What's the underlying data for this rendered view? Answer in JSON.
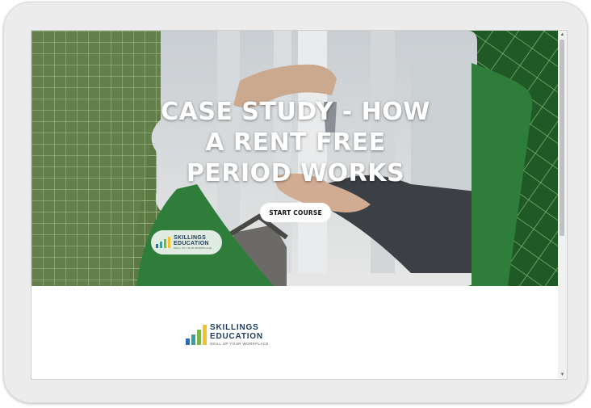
{
  "hero": {
    "title": "CASE STUDY - HOW A RENT FREE PERIOD WORKS",
    "start_button": "START COURSE",
    "logo_brand": "SKILLINGS EDUCATION",
    "logo_tagline": "SKILL UP YOUR WORKPLACE"
  },
  "footer": {
    "logo_brand_line1": "SKILLINGS",
    "logo_brand_line2": "EDUCATION",
    "logo_tagline": "SKILL UP YOUR WORKPLACE"
  },
  "colors": {
    "accent_green": "#2f7d3a",
    "brand_navy": "#1d3a5c",
    "logo_bar_blue": "#2b6cb0",
    "logo_bar_teal": "#3aa0a0",
    "logo_bar_green": "#7ab648",
    "logo_bar_yellow": "#f2c12e"
  },
  "icons": {
    "scroll_up": "scroll-up-arrow-icon",
    "scroll_down": "scroll-down-arrow-icon",
    "logo": "bar-chart-logo-icon"
  }
}
